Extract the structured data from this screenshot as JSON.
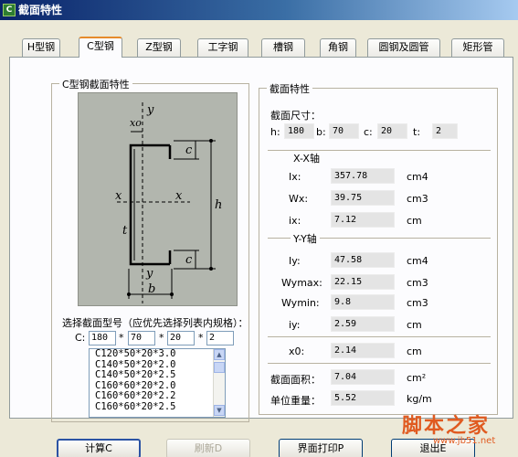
{
  "window": {
    "title": "截面特性",
    "app_icon": "C"
  },
  "tabs": [
    {
      "label": "H型钢",
      "active": false
    },
    {
      "label": "C型钢",
      "active": true
    },
    {
      "label": "Z型钢",
      "active": false
    },
    {
      "label": "工字钢",
      "active": false
    },
    {
      "label": "槽钢",
      "active": false
    },
    {
      "label": "角钢",
      "active": false
    },
    {
      "label": "圆钢及圆管",
      "active": false
    },
    {
      "label": "矩形管",
      "active": false
    }
  ],
  "section_group": {
    "title": "C型钢截面特性",
    "diagram_labels": {
      "xo": "xo",
      "y": "y",
      "x": "x",
      "c": "c",
      "h": "h",
      "t": "t",
      "b": "b"
    }
  },
  "selector": {
    "prompt": "选择截面型号（应优先选择列表内规格）：",
    "prefix": "C:",
    "h": "180",
    "b": "70",
    "c": "20",
    "t": "2",
    "sep": "*"
  },
  "list_items": [
    "C120*50*20*3.0",
    "C140*50*20*2.0",
    "C140*50*20*2.5",
    "C160*60*20*2.0",
    "C160*60*20*2.2",
    "C160*60*20*2.5"
  ],
  "properties": {
    "title": "截面特性",
    "size_title": "截面尺寸：",
    "dims": [
      {
        "label": "h:",
        "value": "180"
      },
      {
        "label": "b:",
        "value": "70"
      },
      {
        "label": "c:",
        "value": "20"
      },
      {
        "label": "t:",
        "value": "2"
      }
    ],
    "xx_title": "X-X轴",
    "xx": [
      {
        "label": "Ix:",
        "value": "357.78",
        "unit": "cm4"
      },
      {
        "label": "Wx:",
        "value": "39.75",
        "unit": "cm3"
      },
      {
        "label": "ix:",
        "value": "7.12",
        "unit": "cm"
      }
    ],
    "yy_title": "Y-Y轴",
    "yy": [
      {
        "label": "Iy:",
        "value": "47.58",
        "unit": "cm4"
      },
      {
        "label": "Wymax:",
        "value": "22.15",
        "unit": "cm3"
      },
      {
        "label": "Wymin:",
        "value": "9.8",
        "unit": "cm3"
      },
      {
        "label": "iy:",
        "value": "2.59",
        "unit": "cm"
      }
    ],
    "x0": {
      "label": "x0:",
      "value": "2.14",
      "unit": "cm"
    },
    "area": {
      "label": "截面面积：",
      "value": "7.04",
      "unit": "cm²"
    },
    "weight": {
      "label": "单位重量：",
      "value": "5.52",
      "unit": "kg/m"
    }
  },
  "buttons": {
    "calc": "计算C",
    "refresh": "刷新D",
    "print": "界面打印P",
    "exit": "退出E"
  },
  "watermark": {
    "text": "脚本之家",
    "url": "www.jb51.net"
  }
}
